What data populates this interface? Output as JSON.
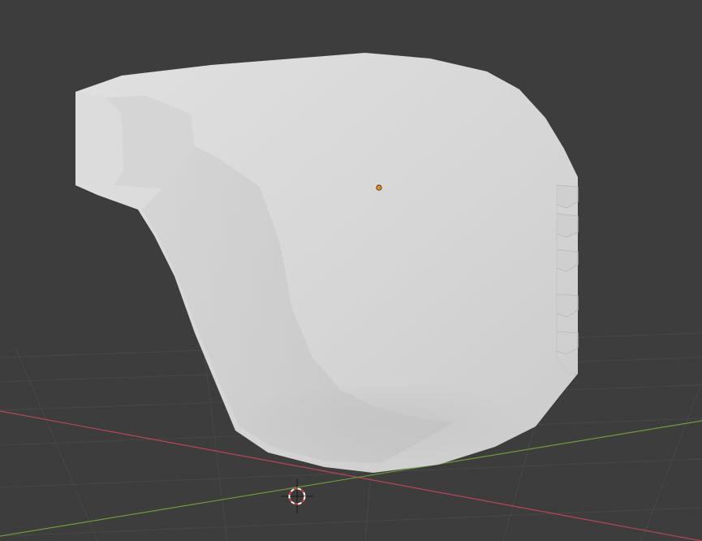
{
  "viewport": {
    "editor": "3D Viewport",
    "background_color": "#3d3d3d",
    "grid_line_color": "#484848",
    "x_axis_color": "#b5475a",
    "y_axis_color": "#6f9a3a"
  },
  "object": {
    "icon": "mesh-object",
    "shading": "solid",
    "base_color": "#d5d5d5",
    "highlight_color": "#e2e2e2",
    "shadow_color": "#bdbdbd",
    "origin_color": "#e8891a"
  },
  "cursor": {
    "icon": "3d-cursor-icon",
    "ring_color_a": "#e23b3b",
    "ring_color_b": "#ffffff"
  }
}
